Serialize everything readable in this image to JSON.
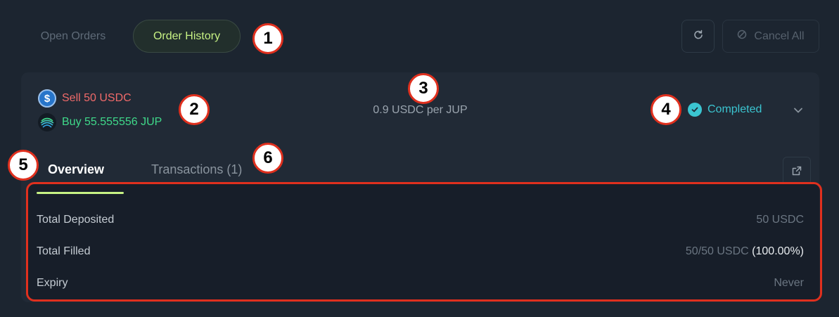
{
  "tabs": {
    "open_orders": "Open Orders",
    "order_history": "Order History"
  },
  "toolbar": {
    "refresh_icon": "refresh-icon",
    "cancel_all": "Cancel All",
    "cancel_icon": "ban-icon"
  },
  "order": {
    "sell_text": "Sell 50 USDC",
    "sell_token_icon": "usdc-icon",
    "sell_token_symbol": "$",
    "buy_text": "Buy 55.555556 JUP",
    "buy_token_icon": "jup-icon",
    "rate": "0.9 USDC per JUP",
    "status": "Completed",
    "status_icon": "check-circle-icon",
    "expand_icon": "chevron-down-icon"
  },
  "detail_tabs": {
    "overview": "Overview",
    "transactions": "Transactions (1)",
    "external_icon": "external-link-icon"
  },
  "details": {
    "rows": [
      {
        "label": "Total Deposited",
        "value": "50 USDC",
        "extra": ""
      },
      {
        "label": "Total Filled",
        "value": "50/50 USDC",
        "extra": "(100.00%)"
      },
      {
        "label": "Expiry",
        "value": "Never",
        "extra": ""
      }
    ]
  },
  "annotations": [
    "1",
    "2",
    "3",
    "4",
    "5",
    "6"
  ],
  "colors": {
    "accent": "#c7f284",
    "sell": "#f06a6a",
    "buy": "#3fd98a",
    "status": "#3bc5d1",
    "annotation": "#e0301e"
  }
}
